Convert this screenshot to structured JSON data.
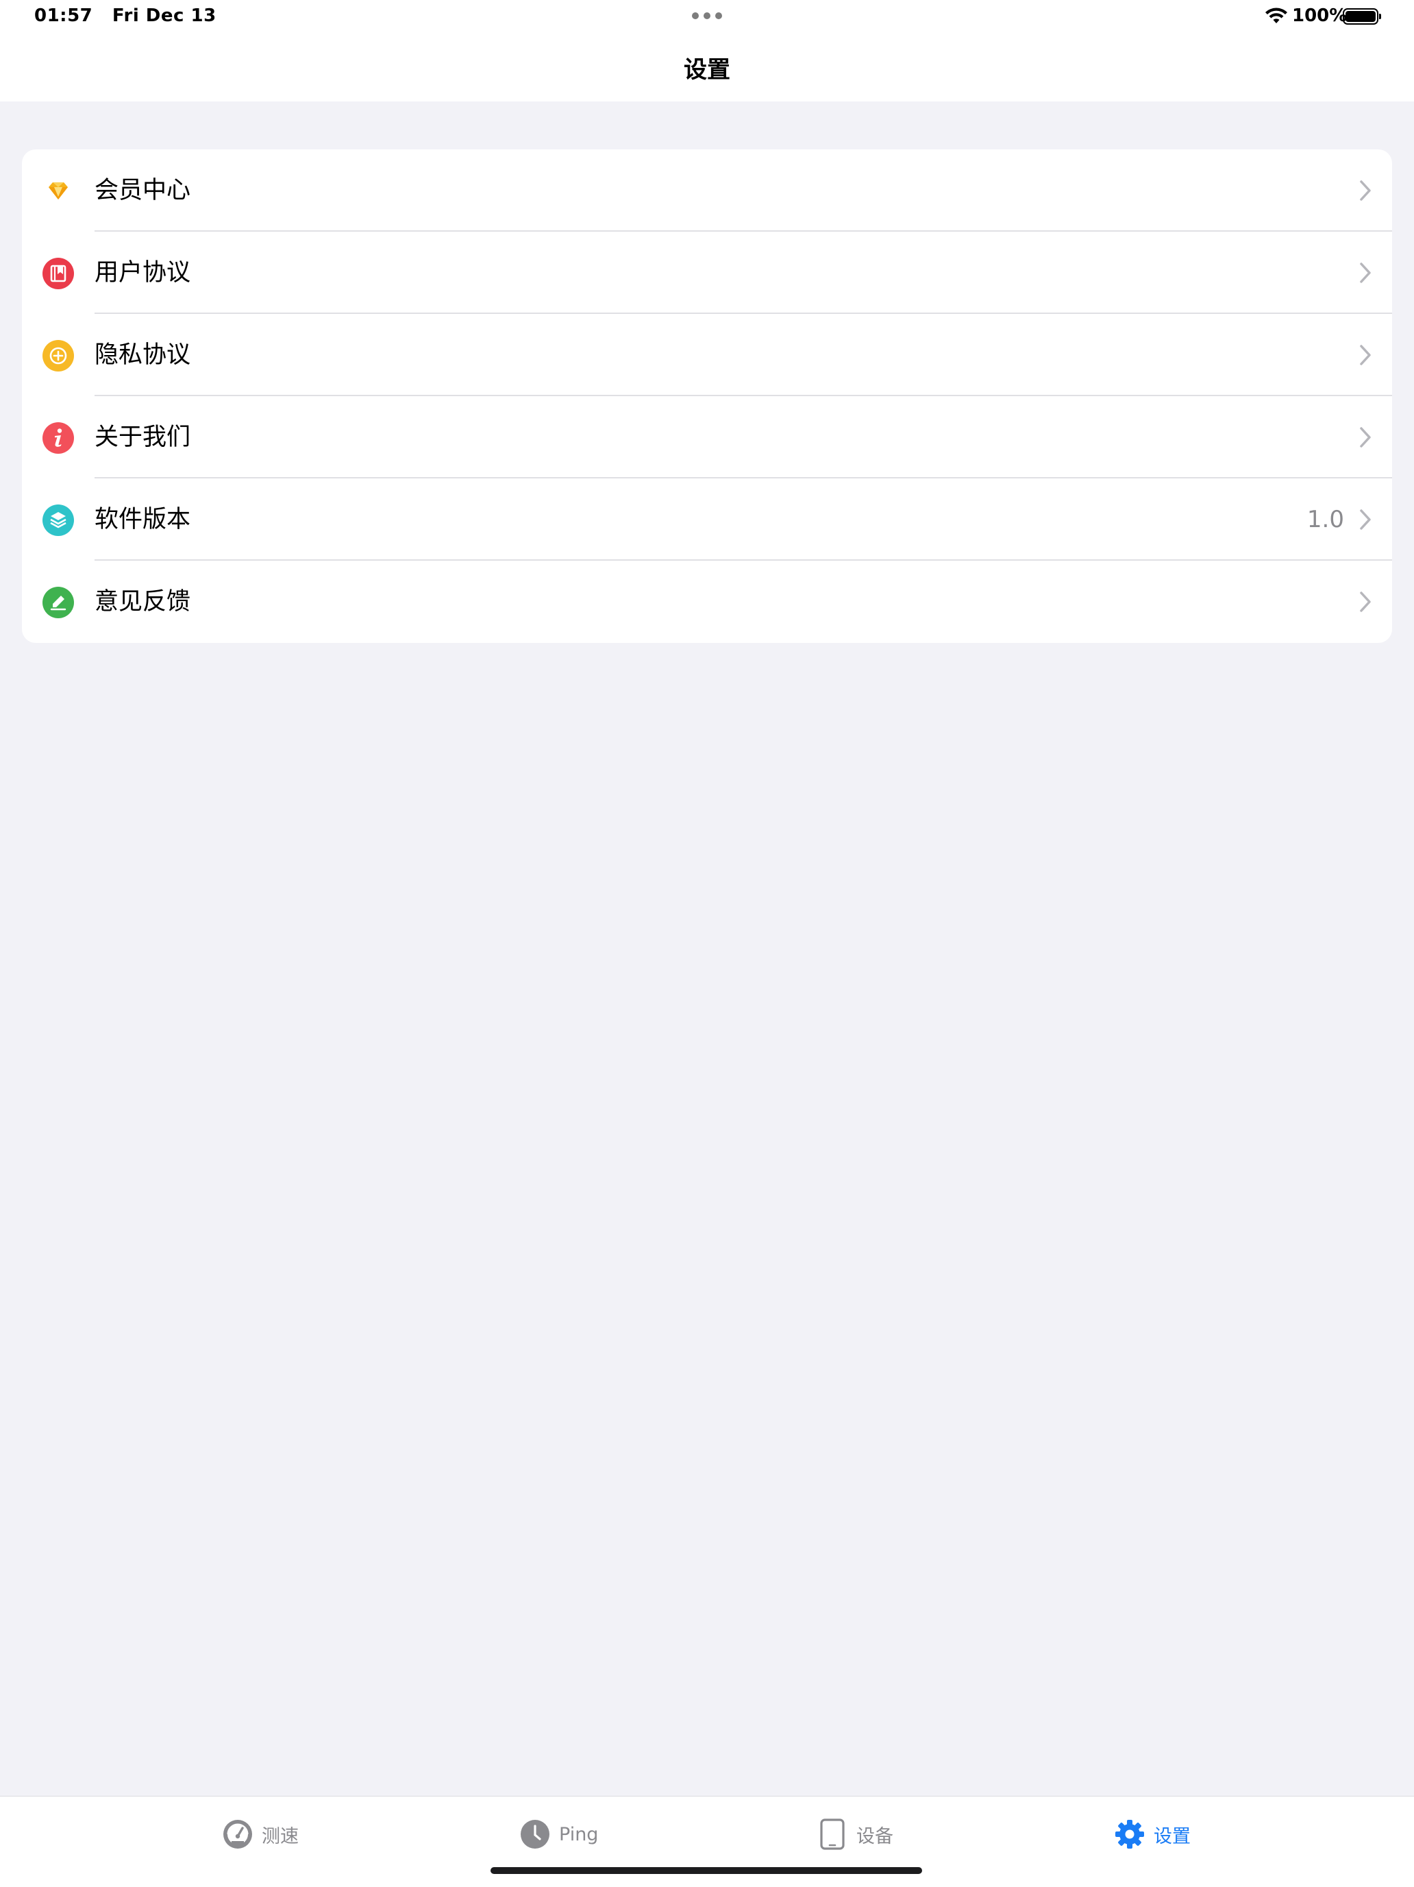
{
  "status_bar": {
    "time": "01:57",
    "date": "Fri Dec 13",
    "battery_percent": "100%",
    "icons": [
      "multitask-dots-icon",
      "wifi-icon",
      "battery-icon"
    ]
  },
  "nav": {
    "title": "设置"
  },
  "settings": {
    "items": [
      {
        "label": "会员中心",
        "icon": "diamond-icon",
        "color": "#f5b21a",
        "value": ""
      },
      {
        "label": "用户协议",
        "icon": "book-icon",
        "color": "#ea3b4a",
        "value": ""
      },
      {
        "label": "隐私协议",
        "icon": "shield-plus-icon",
        "color": "#f7b926",
        "value": ""
      },
      {
        "label": "关于我们",
        "icon": "info-icon",
        "color": "#f2505a",
        "value": ""
      },
      {
        "label": "软件版本",
        "icon": "layers-icon",
        "color": "#2ec3c9",
        "value": "1.0"
      },
      {
        "label": "意见反馈",
        "icon": "pencil-icon",
        "color": "#3fb24f",
        "value": ""
      }
    ]
  },
  "tab_bar": {
    "tabs": [
      {
        "label": "测速",
        "icon": "speedometer-icon",
        "active": false
      },
      {
        "label": "Ping",
        "icon": "clock-icon",
        "active": false
      },
      {
        "label": "设备",
        "icon": "tablet-icon",
        "active": false
      },
      {
        "label": "设置",
        "icon": "gear-icon",
        "active": true
      }
    ],
    "active_color": "#1a7cf5",
    "inactive_color": "#8a8a8e"
  }
}
